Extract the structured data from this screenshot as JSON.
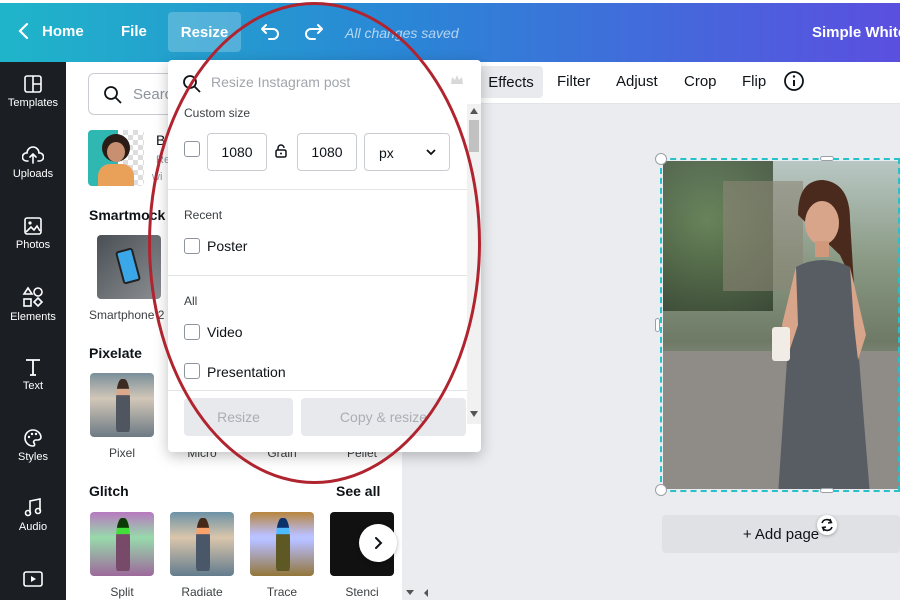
{
  "topbar": {
    "home": "Home",
    "file": "File",
    "resize": "Resize",
    "saved": "All changes saved",
    "doc_title": "Simple White"
  },
  "rail": [
    {
      "label": "Templates",
      "icon": "templates-icon"
    },
    {
      "label": "Uploads",
      "icon": "uploads-icon"
    },
    {
      "label": "Photos",
      "icon": "photos-icon"
    },
    {
      "label": "Elements",
      "icon": "elements-icon"
    },
    {
      "label": "Text",
      "icon": "text-icon"
    },
    {
      "label": "Styles",
      "icon": "styles-icon"
    },
    {
      "label": "Audio",
      "icon": "audio-icon"
    },
    {
      "label": "",
      "icon": "video-icon"
    }
  ],
  "panel": {
    "search_placeholder": "Searc",
    "bg_remover": {
      "title": "B",
      "sub1": "Re",
      "sub2": "wi"
    },
    "smartmockups": {
      "title": "Smartmock",
      "item": "Smartphone 2"
    },
    "pixelate": {
      "title": "Pixelate",
      "items": [
        "Pixel",
        "Micro",
        "Grain",
        "Pellet"
      ]
    },
    "glitch": {
      "title": "Glitch",
      "see_all": "See all",
      "items": [
        "Split",
        "Radiate",
        "Trace",
        "Stenci"
      ]
    }
  },
  "toolbar": {
    "effects": "Effects",
    "filter": "Filter",
    "adjust": "Adjust",
    "crop": "Crop",
    "flip": "Flip"
  },
  "canvas": {
    "add_page": "+ Add page"
  },
  "dropdown": {
    "search_placeholder": "Resize Instagram post",
    "custom_size": "Custom size",
    "width": "1080",
    "height": "1080",
    "unit": "px",
    "recent": "Recent",
    "recent_items": [
      "Poster"
    ],
    "all": "All",
    "all_items": [
      "Video",
      "Presentation"
    ],
    "resize_btn": "Resize",
    "copy_resize_btn": "Copy & resize"
  },
  "colors": {
    "annotation": "#b0242f",
    "accent_teal": "#26c1c9",
    "rail_bg": "#1b1f24"
  }
}
